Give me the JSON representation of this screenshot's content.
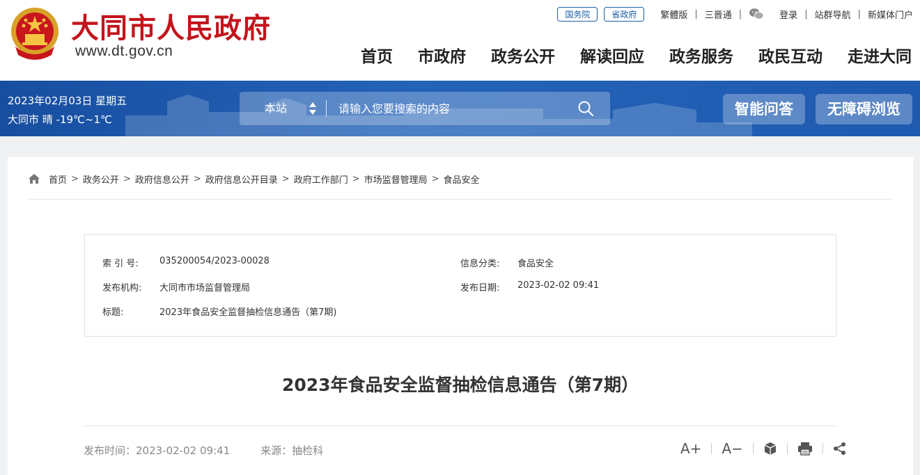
{
  "header": {
    "site_name": "大同市人民政府",
    "site_url": "www.dt.gov.cn",
    "top_links": {
      "guowuyuan": "国务院",
      "shengzhengfu": "省政府",
      "traditional": "繁體版",
      "sanjintong": "三晋通",
      "login": "登录",
      "site_nav": "站群导航",
      "new_media": "新媒体门户"
    },
    "nav": [
      "首页",
      "市政府",
      "政务公开",
      "解读回应",
      "政务服务",
      "政民互动",
      "走进大同"
    ]
  },
  "banner": {
    "date_line": "2023年02月03日 星期五",
    "weather_line": "大同市 晴 -19℃~1℃",
    "search_scope": "本站",
    "search_placeholder": "请输入您要搜索的内容",
    "btn_qa": "智能问答",
    "btn_accessible": "无障碍浏览"
  },
  "breadcrumb": [
    "首页",
    "政务公开",
    "政府信息公开",
    "政府信息公开目录",
    "政府工作部门",
    "市场监督管理局",
    "食品安全"
  ],
  "info": {
    "index_label": "索 引 号:",
    "index_value": "035200054/2023-00028",
    "category_label": "信息分类:",
    "category_value": "食品安全",
    "publisher_label": "发布机构:",
    "publisher_value": "大同市市场监督管理局",
    "date_label": "发布日期:",
    "date_value": "2023-02-02 09:41",
    "title_label": "标题:",
    "title_value": "2023年食品安全监督抽检信息通告（第7期)"
  },
  "article": {
    "title": "2023年食品安全监督抽检信息通告（第7期）",
    "publish_time": "发布时间：2023-02-02 09:41",
    "source": "来源：抽检科",
    "font_increase": "A+",
    "font_decrease": "A−"
  },
  "colors": {
    "brand_red": "#c3141c",
    "banner_blue": "#1e5ab0",
    "pill_blue": "#1c5ea8"
  }
}
